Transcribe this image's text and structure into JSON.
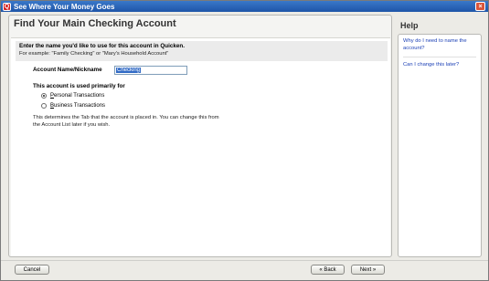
{
  "window": {
    "title": "See Where Your Money Goes",
    "app_icon_letter": "Q",
    "close_glyph": "×"
  },
  "main": {
    "page_title": "Find Your Main Checking Account",
    "prompt": "Enter the name you'd like to use for this account in Quicken.",
    "prompt_example": "For example: \"Family Checking\" or \"Mary's Household Account\"",
    "field_label": "Account Name/Nickname",
    "field_value": "Checking",
    "usage_label": "This account is used primarily for",
    "options": [
      {
        "hot": "P",
        "rest": "ersonal Transactions",
        "checked": true
      },
      {
        "hot": "B",
        "rest": "usiness Transactions",
        "checked": false
      }
    ],
    "help_text": "This determines the Tab that the account is placed in. You can change this from the Account List later if you wish."
  },
  "help": {
    "title": "Help",
    "links": [
      "Why do I need to name the account?",
      "Can I change this later?"
    ]
  },
  "footer": {
    "cancel_label": "Cancel",
    "back_label": "« Back",
    "next_label": "Next »"
  },
  "colors": {
    "titlebar": "#1e55a8",
    "link": "#1a3fb5",
    "selection": "#316ac5"
  }
}
